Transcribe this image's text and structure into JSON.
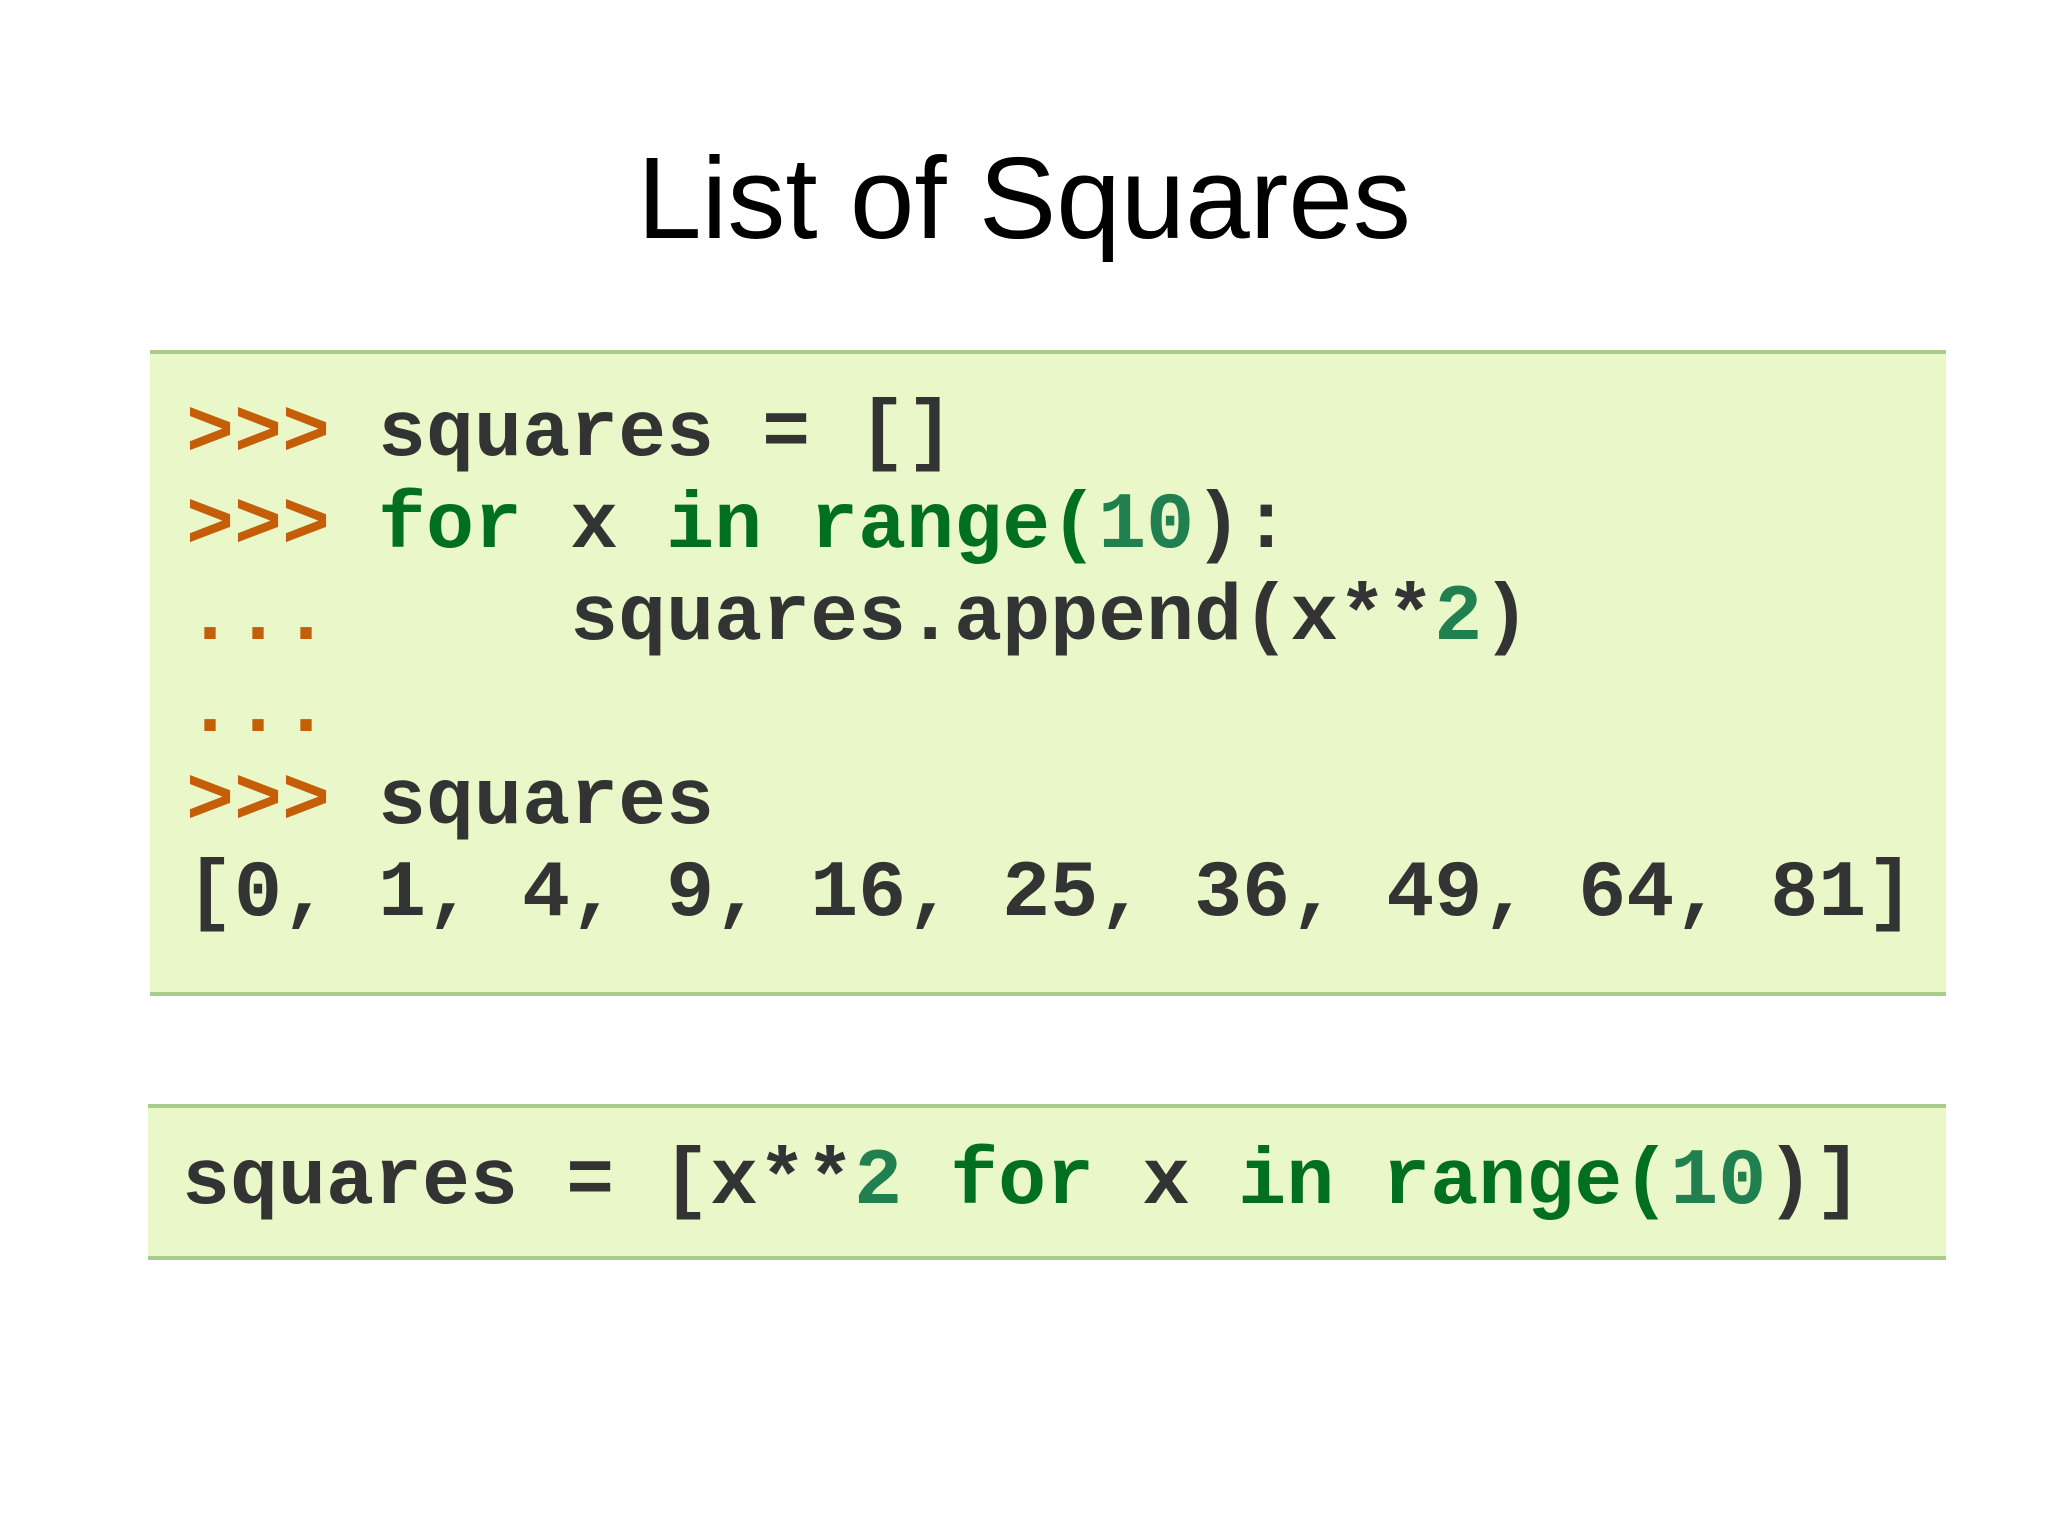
{
  "slide": {
    "title": "List of Squares"
  },
  "code_block_1": {
    "line_1": {
      "prompt": ">>>",
      "text": " squares = []"
    },
    "line_2": {
      "prompt": ">>>",
      "kw_for": " for",
      "var": " x",
      "kw_in": " in",
      "func": " range(",
      "num": "10",
      "tail": "):"
    },
    "line_3": {
      "prompt": "...",
      "text": "     squares.append(x**",
      "num": "2",
      "tail": ")"
    },
    "line_4": {
      "prompt": "..."
    },
    "line_5": {
      "prompt": ">>>",
      "text": " squares"
    },
    "line_6": {
      "output": "[0, 1, 4, 9, 16, 25, 36, 49, 64, 81]"
    }
  },
  "code_block_2": {
    "part_1": "squares = [x**",
    "num_2": "2",
    "kw_for": " for",
    "var": " x",
    "kw_in": " in",
    "func": " range(",
    "num_10": "10",
    "tail": ")]"
  },
  "colors": {
    "code_background": "#eaf7c9",
    "code_border": "#a8cc8c",
    "prompt": "#c65d09",
    "keyword": "#007020",
    "number": "#208050"
  }
}
